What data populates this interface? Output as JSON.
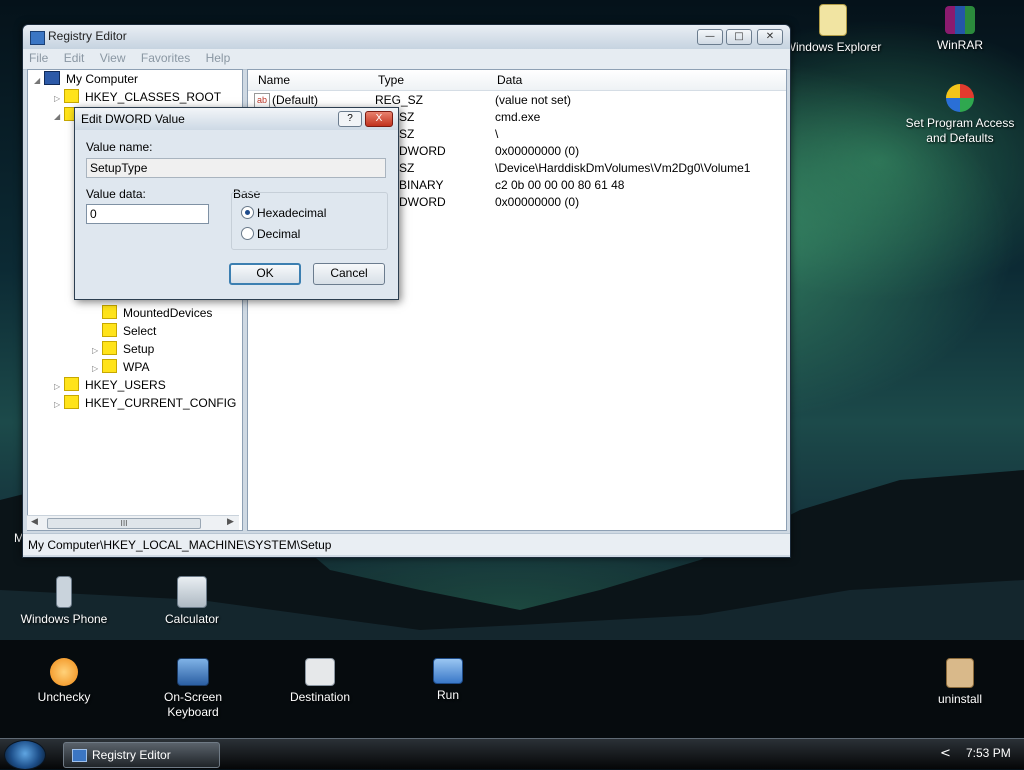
{
  "desktop": {
    "icons": [
      {
        "label": "Windows Explorer",
        "icon": "magnifier-folder-icon"
      },
      {
        "label": "WinRAR",
        "icon": "winrar-books-icon"
      },
      {
        "label": "Set Program Access and Defaults",
        "icon": "program-access-icon"
      },
      {
        "label": "Windows Phone",
        "icon": "phone-icon"
      },
      {
        "label": "Calculator",
        "icon": "calculator-icon"
      },
      {
        "label": "Unchecky",
        "icon": "unchecky-icon"
      },
      {
        "label": "On-Screen Keyboard",
        "icon": "keyboard-icon"
      },
      {
        "label": "Destination",
        "icon": "envelope-icon"
      },
      {
        "label": "Run",
        "icon": "run-icon"
      },
      {
        "label": "uninstall",
        "icon": "uninstall-icon"
      }
    ],
    "partial_label": "M"
  },
  "registry": {
    "title": "Registry Editor",
    "menu": [
      "File",
      "Edit",
      "View",
      "Favorites",
      "Help"
    ],
    "tree": [
      {
        "label": "My Computer"
      },
      {
        "label": "HKEY_CLASSES_ROOT"
      },
      {
        "label": "MountedDevices"
      },
      {
        "label": "Select"
      },
      {
        "label": "Setup"
      },
      {
        "label": "WPA"
      },
      {
        "label": "HKEY_USERS"
      },
      {
        "label": "HKEY_CURRENT_CONFIG"
      }
    ],
    "scroll_grip": "III",
    "columns": {
      "name": "Name",
      "type": "Type",
      "data": "Data"
    },
    "rows": [
      {
        "name": "(Default)",
        "type": "REG_SZ",
        "data": "(value not set)"
      },
      {
        "name": "",
        "type": "SZ",
        "data": "cmd.exe"
      },
      {
        "name": "",
        "type": "SZ",
        "data": "\\"
      },
      {
        "name": "",
        "type": "DWORD",
        "data": "0x00000000 (0)"
      },
      {
        "name": "",
        "type": "SZ",
        "data": "\\Device\\HarddiskDmVolumes\\Vm2Dg0\\Volume1"
      },
      {
        "name": "",
        "type": "BINARY",
        "data": "c2 0b 00 00 00 80 61 48"
      },
      {
        "name": "",
        "type": "DWORD",
        "data": "0x00000000 (0)"
      }
    ],
    "status_path": "My Computer\\HKEY_LOCAL_MACHINE\\SYSTEM\\Setup"
  },
  "dialog": {
    "title": "Edit DWORD Value",
    "help": "?",
    "close": "X",
    "value_name_label": "Value name:",
    "value_name": "SetupType",
    "value_data_label": "Value data:",
    "value_data": "0",
    "base_label": "Base",
    "hex_label": "Hexadecimal",
    "dec_label": "Decimal",
    "selected_base": "Hexadecimal",
    "ok": "OK",
    "cancel": "Cancel"
  },
  "taskbar": {
    "task_label": "Registry Editor",
    "tray_arrow": "<",
    "clock": "7:53 PM"
  }
}
